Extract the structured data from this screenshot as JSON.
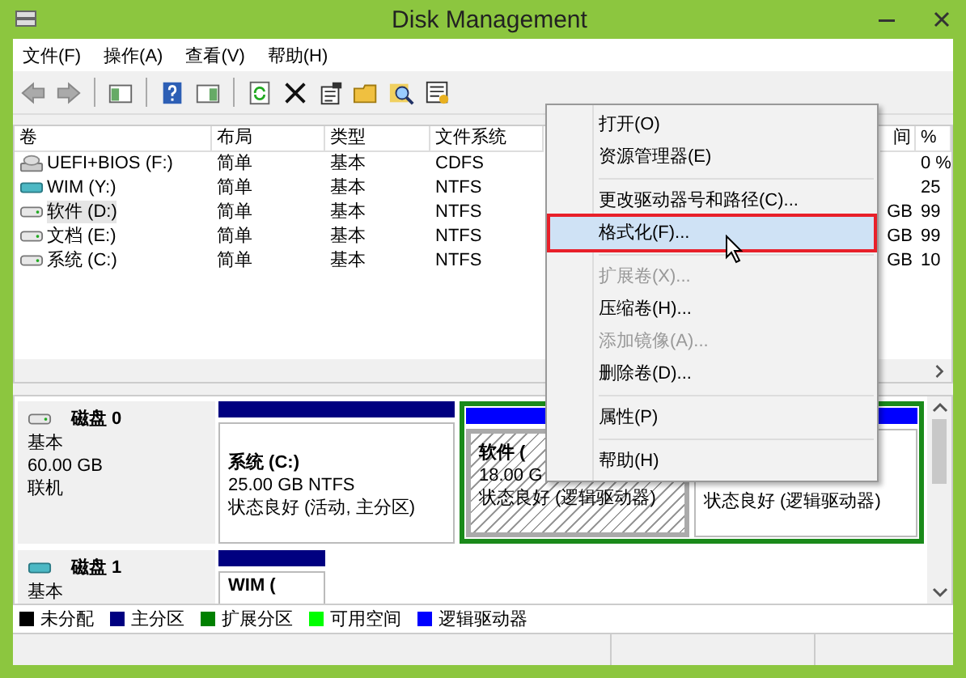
{
  "window": {
    "title": "Disk Management"
  },
  "menu_bar": [
    "文件(F)",
    "操作(A)",
    "查看(V)",
    "帮助(H)"
  ],
  "volume_table": {
    "columns": [
      "卷",
      "布局",
      "类型",
      "文件系统",
      "间",
      "%"
    ],
    "rows": [
      {
        "name": "UEFI+BIOS (F:)",
        "kind": "optical",
        "layout": "简单",
        "type": "基本",
        "file_system": "CDFS",
        "column_6": "0 %",
        "selected": false
      },
      {
        "name": "WIM (Y:)",
        "kind": "removable",
        "layout": "简单",
        "type": "基本",
        "file_system": "NTFS",
        "column_6": "25",
        "selected": false
      },
      {
        "name": "软件 (D:)",
        "kind": "disk",
        "layout": "简单",
        "type": "基本",
        "file_system": "NTFS",
        "column_5": "GB",
        "column_6": "99",
        "selected": true
      },
      {
        "name": "文档 (E:)",
        "kind": "disk",
        "layout": "简单",
        "type": "基本",
        "file_system": "NTFS",
        "column_5": "GB",
        "column_6": "99",
        "selected": false
      },
      {
        "name": "系统 (C:)",
        "kind": "disk",
        "layout": "简单",
        "type": "基本",
        "file_system": "NTFS",
        "column_5": "GB",
        "column_6": "10",
        "selected": false
      }
    ]
  },
  "disks": [
    {
      "title": "磁盘 0",
      "kind": "disk",
      "type": "基本",
      "size": "60.00 GB",
      "status": "联机",
      "partitions": [
        {
          "kind": "primary",
          "title": "系统 (C:)",
          "lines": [
            "25.00 GB NTFS",
            "状态良好 (活动, 主分区)"
          ]
        },
        {
          "kind": "extended",
          "children": [
            {
              "kind": "logical",
              "selected": true,
              "title": "软件 (",
              "lines": [
                "18.00 G",
                "状态良好 (逻辑驱动器)"
              ]
            },
            {
              "kind": "logical",
              "selected": false,
              "lines": [
                "状态良好 (逻辑驱动器)"
              ]
            }
          ]
        }
      ]
    },
    {
      "title": "磁盘 1",
      "kind": "removable",
      "type": "基本",
      "partitions": [
        {
          "kind": "primary",
          "title": "WIM ("
        }
      ]
    }
  ],
  "legend": [
    {
      "label": "未分配",
      "color": "#000000"
    },
    {
      "label": "主分区",
      "color": "#000080"
    },
    {
      "label": "扩展分区",
      "color": "#008000"
    },
    {
      "label": "可用空间",
      "color": "#00ff00"
    },
    {
      "label": "逻辑驱动器",
      "color": "#0000ff"
    }
  ],
  "context_menu": [
    {
      "kind": "item",
      "label": "打开(O)",
      "disabled": false,
      "selected": false
    },
    {
      "kind": "item",
      "label": "资源管理器(E)",
      "disabled": false,
      "selected": false
    },
    {
      "kind": "separator"
    },
    {
      "kind": "item",
      "label": "更改驱动器号和路径(C)...",
      "disabled": false,
      "selected": false
    },
    {
      "kind": "item",
      "label": "格式化(F)...",
      "disabled": false,
      "selected": true
    },
    {
      "kind": "separator"
    },
    {
      "kind": "item",
      "label": "扩展卷(X)...",
      "disabled": true,
      "selected": false
    },
    {
      "kind": "item",
      "label": "压缩卷(H)...",
      "disabled": false,
      "selected": false
    },
    {
      "kind": "item",
      "label": "添加镜像(A)...",
      "disabled": true,
      "selected": false
    },
    {
      "kind": "item",
      "label": "删除卷(D)...",
      "disabled": false,
      "selected": false
    },
    {
      "kind": "separator"
    },
    {
      "kind": "item",
      "label": "属性(P)",
      "disabled": false,
      "selected": false
    },
    {
      "kind": "separator"
    },
    {
      "kind": "item",
      "label": "帮助(H)",
      "disabled": false,
      "selected": false
    }
  ]
}
